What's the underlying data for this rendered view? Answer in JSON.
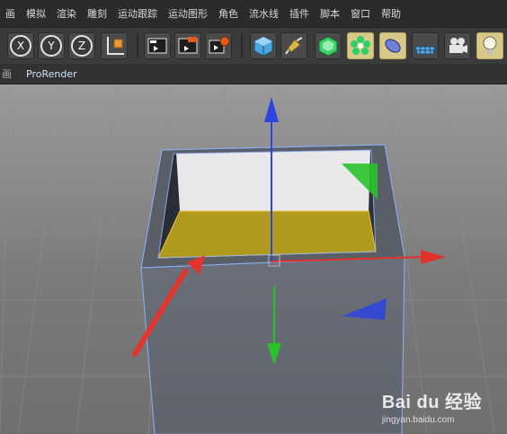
{
  "menu": {
    "items": [
      {
        "label": "画"
      },
      {
        "label": "模拟"
      },
      {
        "label": "渲染"
      },
      {
        "label": "雕刻"
      },
      {
        "label": "运动跟踪"
      },
      {
        "label": "运动图形"
      },
      {
        "label": "角色"
      },
      {
        "label": "流水线"
      },
      {
        "label": "插件"
      },
      {
        "label": "脚本"
      },
      {
        "label": "窗口"
      },
      {
        "label": "帮助"
      }
    ]
  },
  "toolbar": {
    "icons": [
      {
        "name": "x-axis-lock-icon",
        "label": "X"
      },
      {
        "name": "y-axis-lock-icon",
        "label": "Y"
      },
      {
        "name": "z-axis-lock-icon",
        "label": "Z"
      },
      {
        "name": "coordinate-system-icon"
      },
      {
        "name": "render-view-icon"
      },
      {
        "name": "render-to-picture-viewer-icon"
      },
      {
        "name": "render-settings-icon"
      },
      {
        "name": "cube-primitive-icon"
      },
      {
        "name": "pen-spline-icon"
      },
      {
        "name": "subdivision-surface-icon"
      },
      {
        "name": "cloner-icon"
      },
      {
        "name": "deformer-icon"
      },
      {
        "name": "floor-environment-icon"
      },
      {
        "name": "camera-icon"
      },
      {
        "name": "light-icon"
      }
    ]
  },
  "subbar": {
    "tab_label": "ProRender",
    "left_fragment": "画"
  },
  "watermark": {
    "brand": "Bai du 经验",
    "site": "jingyan.baidu.com"
  },
  "colors": {
    "menubar_bg": "#2b2b2b",
    "toolbar_bg": "#3b3b3b",
    "viewport_bg": "#454545",
    "selected_polygon": "#b09a1e",
    "axis_x": "#e0322b",
    "axis_y": "#29c22b",
    "axis_z": "#2c44e0",
    "annotation_arrow": "#e3342d"
  }
}
